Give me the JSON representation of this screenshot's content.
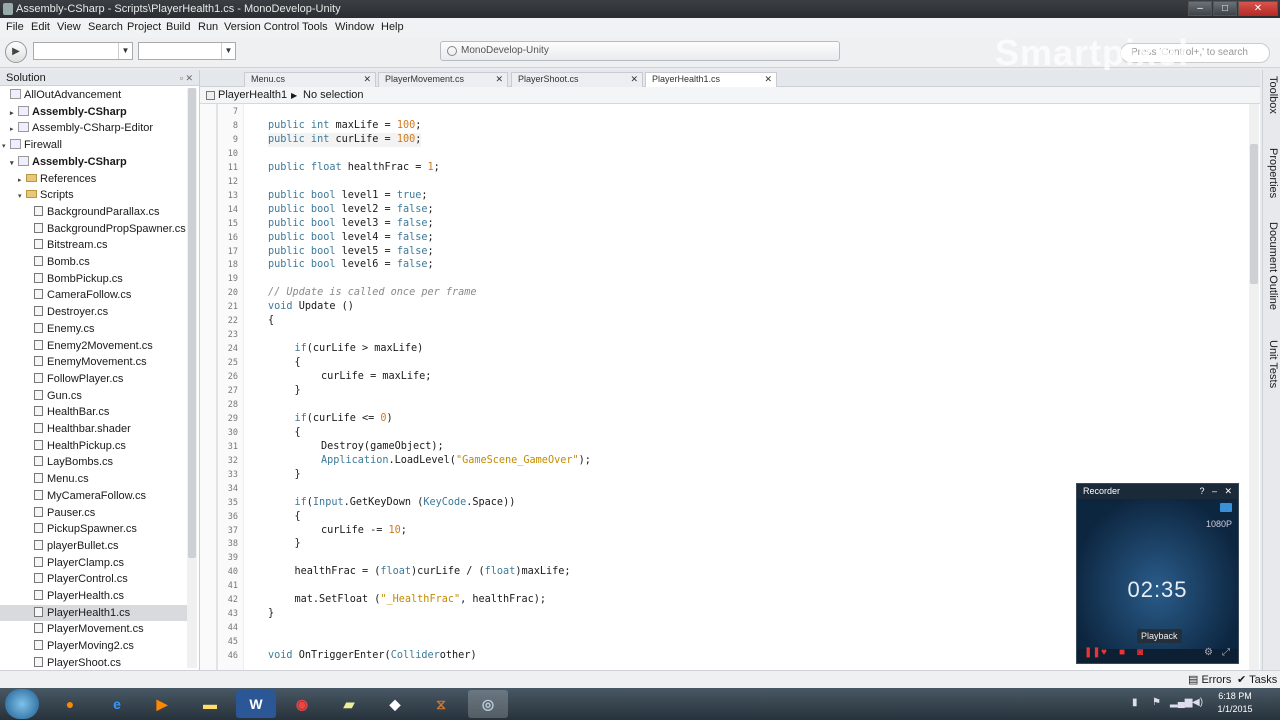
{
  "window": {
    "title": "Assembly-CSharp - Scripts\\PlayerHealth1.cs - MonoDevelop-Unity"
  },
  "menu": [
    "File",
    "Edit",
    "View",
    "Search",
    "Project",
    "Build",
    "Run",
    "Version Control",
    "Tools",
    "Window",
    "Help"
  ],
  "toolbar": {
    "status_text": "MonoDevelop-Unity",
    "search_placeholder": "Press 'Control+,' to search"
  },
  "watermark": "Smartpixel",
  "solution": {
    "title": "Solution",
    "items": [
      {
        "label": "AllOutAdvancement",
        "level": 0,
        "expand": "",
        "type": "sln",
        "bold": false
      },
      {
        "label": "Assembly-CSharp",
        "level": 1,
        "expand": "▸",
        "type": "proj",
        "bold": true
      },
      {
        "label": "Assembly-CSharp-Editor",
        "level": 1,
        "expand": "▸",
        "type": "proj",
        "bold": false
      },
      {
        "label": "Firewall",
        "level": 0,
        "expand": "▾",
        "type": "sln",
        "bold": false
      },
      {
        "label": "Assembly-CSharp",
        "level": 1,
        "expand": "▾",
        "type": "proj",
        "bold": true
      },
      {
        "label": "References",
        "level": 2,
        "expand": "▸",
        "type": "folder",
        "bold": false
      },
      {
        "label": "Scripts",
        "level": 2,
        "expand": "▾",
        "type": "folder",
        "bold": false
      },
      {
        "label": "BackgroundParallax.cs",
        "level": 3,
        "expand": "",
        "type": "file",
        "bold": false
      },
      {
        "label": "BackgroundPropSpawner.cs",
        "level": 3,
        "expand": "",
        "type": "file",
        "bold": false
      },
      {
        "label": "Bitstream.cs",
        "level": 3,
        "expand": "",
        "type": "file",
        "bold": false
      },
      {
        "label": "Bomb.cs",
        "level": 3,
        "expand": "",
        "type": "file",
        "bold": false
      },
      {
        "label": "BombPickup.cs",
        "level": 3,
        "expand": "",
        "type": "file",
        "bold": false
      },
      {
        "label": "CameraFollow.cs",
        "level": 3,
        "expand": "",
        "type": "file",
        "bold": false
      },
      {
        "label": "Destroyer.cs",
        "level": 3,
        "expand": "",
        "type": "file",
        "bold": false
      },
      {
        "label": "Enemy.cs",
        "level": 3,
        "expand": "",
        "type": "file",
        "bold": false
      },
      {
        "label": "Enemy2Movement.cs",
        "level": 3,
        "expand": "",
        "type": "file",
        "bold": false
      },
      {
        "label": "EnemyMovement.cs",
        "level": 3,
        "expand": "",
        "type": "file",
        "bold": false
      },
      {
        "label": "FollowPlayer.cs",
        "level": 3,
        "expand": "",
        "type": "file",
        "bold": false
      },
      {
        "label": "Gun.cs",
        "level": 3,
        "expand": "",
        "type": "file",
        "bold": false
      },
      {
        "label": "HealthBar.cs",
        "level": 3,
        "expand": "",
        "type": "file",
        "bold": false
      },
      {
        "label": "Healthbar.shader",
        "level": 3,
        "expand": "",
        "type": "file",
        "bold": false
      },
      {
        "label": "HealthPickup.cs",
        "level": 3,
        "expand": "",
        "type": "file",
        "bold": false
      },
      {
        "label": "LayBombs.cs",
        "level": 3,
        "expand": "",
        "type": "file",
        "bold": false
      },
      {
        "label": "Menu.cs",
        "level": 3,
        "expand": "",
        "type": "file",
        "bold": false
      },
      {
        "label": "MyCameraFollow.cs",
        "level": 3,
        "expand": "",
        "type": "file",
        "bold": false
      },
      {
        "label": "Pauser.cs",
        "level": 3,
        "expand": "",
        "type": "file",
        "bold": false
      },
      {
        "label": "PickupSpawner.cs",
        "level": 3,
        "expand": "",
        "type": "file",
        "bold": false
      },
      {
        "label": "playerBullet.cs",
        "level": 3,
        "expand": "",
        "type": "file",
        "bold": false
      },
      {
        "label": "PlayerClamp.cs",
        "level": 3,
        "expand": "",
        "type": "file",
        "bold": false
      },
      {
        "label": "PlayerControl.cs",
        "level": 3,
        "expand": "",
        "type": "file",
        "bold": false
      },
      {
        "label": "PlayerHealth.cs",
        "level": 3,
        "expand": "",
        "type": "file",
        "bold": false
      },
      {
        "label": "PlayerHealth1.cs",
        "level": 3,
        "expand": "",
        "type": "file",
        "bold": false,
        "selected": true
      },
      {
        "label": "PlayerMovement.cs",
        "level": 3,
        "expand": "",
        "type": "file",
        "bold": false
      },
      {
        "label": "PlayerMoving2.cs",
        "level": 3,
        "expand": "",
        "type": "file",
        "bold": false
      },
      {
        "label": "PlayerShoot.cs",
        "level": 3,
        "expand": "",
        "type": "file",
        "bold": false
      }
    ]
  },
  "tabs": [
    {
      "label": "Menu.cs"
    },
    {
      "label": "PlayerMovement.cs"
    },
    {
      "label": "PlayerShoot.cs"
    },
    {
      "label": "PlayerHealth1.cs",
      "active": true
    }
  ],
  "breadcrumb": {
    "class_name": "PlayerHealth1",
    "selection": "No selection"
  },
  "code": [
    {
      "n": "7",
      "t": []
    },
    {
      "n": "8",
      "t": [
        [
          "kw",
          "public int"
        ],
        [
          "",
          "maxLife = "
        ],
        [
          "num",
          "100"
        ],
        [
          "",
          ";"
        ]
      ],
      "indent": 1
    },
    {
      "n": "9",
      "t": [
        [
          "kw",
          "public int"
        ],
        [
          "",
          "curLife = "
        ],
        [
          "num",
          "100"
        ],
        [
          "",
          ";"
        ]
      ],
      "indent": 1,
      "hl": true
    },
    {
      "n": "10",
      "t": []
    },
    {
      "n": "11",
      "t": [
        [
          "kw",
          "public float"
        ],
        [
          "",
          "healthFrac = "
        ],
        [
          "num",
          "1"
        ],
        [
          "",
          ";"
        ]
      ],
      "indent": 1
    },
    {
      "n": "12",
      "t": []
    },
    {
      "n": "13",
      "t": [
        [
          "kw",
          "public bool"
        ],
        [
          "",
          "level1 = "
        ],
        [
          "kw",
          "true"
        ],
        [
          "",
          ";"
        ]
      ],
      "indent": 1
    },
    {
      "n": "14",
      "t": [
        [
          "kw",
          "public bool"
        ],
        [
          "",
          "level2 = "
        ],
        [
          "kw",
          "false"
        ],
        [
          "",
          ";"
        ]
      ],
      "indent": 1
    },
    {
      "n": "15",
      "t": [
        [
          "kw",
          "public bool"
        ],
        [
          "",
          "level3 = "
        ],
        [
          "kw",
          "false"
        ],
        [
          "",
          ";"
        ]
      ],
      "indent": 1
    },
    {
      "n": "16",
      "t": [
        [
          "kw",
          "public bool"
        ],
        [
          "",
          "level4 = "
        ],
        [
          "kw",
          "false"
        ],
        [
          "",
          ";"
        ]
      ],
      "indent": 1
    },
    {
      "n": "17",
      "t": [
        [
          "kw",
          "public bool"
        ],
        [
          "",
          "level5 = "
        ],
        [
          "kw",
          "false"
        ],
        [
          "",
          ";"
        ]
      ],
      "indent": 1
    },
    {
      "n": "18",
      "t": [
        [
          "kw",
          "public bool"
        ],
        [
          "",
          "level6 = "
        ],
        [
          "kw",
          "false"
        ],
        [
          "",
          ";"
        ]
      ],
      "indent": 1
    },
    {
      "n": "19",
      "t": []
    },
    {
      "n": "20",
      "t": [
        [
          "cm",
          "// Update is called once per frame"
        ]
      ],
      "indent": 1
    },
    {
      "n": "21",
      "t": [
        [
          "kw",
          "void"
        ],
        [
          "",
          "Update ()"
        ]
      ],
      "indent": 1
    },
    {
      "n": "22",
      "t": [
        [
          "",
          "{"
        ]
      ],
      "indent": 1
    },
    {
      "n": "23",
      "t": []
    },
    {
      "n": "24",
      "t": [
        [
          "kw",
          "if"
        ],
        [
          "",
          "(curLife > maxLife)"
        ]
      ],
      "indent": 2
    },
    {
      "n": "25",
      "t": [
        [
          "",
          "{"
        ]
      ],
      "indent": 2
    },
    {
      "n": "26",
      "t": [
        [
          "",
          "curLife = maxLife;"
        ]
      ],
      "indent": 3
    },
    {
      "n": "27",
      "t": [
        [
          "",
          "}"
        ]
      ],
      "indent": 2
    },
    {
      "n": "28",
      "t": []
    },
    {
      "n": "29",
      "t": [
        [
          "kw",
          "if"
        ],
        [
          "",
          "(curLife <= "
        ],
        [
          "num",
          "0"
        ],
        [
          "",
          ")"
        ]
      ],
      "indent": 2,
      "nosp": true
    },
    {
      "n": "30",
      "t": [
        [
          "",
          "{"
        ]
      ],
      "indent": 2
    },
    {
      "n": "31",
      "t": [
        [
          "",
          "Destroy(gameObject);"
        ]
      ],
      "indent": 3
    },
    {
      "n": "32",
      "t": [
        [
          "ty",
          "Application"
        ],
        [
          "",
          ".LoadLevel("
        ],
        [
          "str",
          "\"GameScene_GameOver\""
        ],
        [
          "",
          ");"
        ]
      ],
      "indent": 3,
      "nosp": true
    },
    {
      "n": "33",
      "t": [
        [
          "",
          "}"
        ]
      ],
      "indent": 2
    },
    {
      "n": "34",
      "t": []
    },
    {
      "n": "35",
      "t": [
        [
          "kw",
          "if"
        ],
        [
          "",
          "("
        ],
        [
          "ty",
          "Input"
        ],
        [
          "",
          ".GetKeyDown ("
        ],
        [
          "ty",
          "KeyCode"
        ],
        [
          "",
          ".Space))"
        ]
      ],
      "indent": 2,
      "nosp2": true
    },
    {
      "n": "36",
      "t": [
        [
          "",
          "{"
        ]
      ],
      "indent": 2
    },
    {
      "n": "37",
      "t": [
        [
          "",
          "curLife -= "
        ],
        [
          "num",
          "10"
        ],
        [
          "",
          ";"
        ]
      ],
      "indent": 3,
      "nosp": true
    },
    {
      "n": "38",
      "t": [
        [
          "",
          "}"
        ]
      ],
      "indent": 2
    },
    {
      "n": "39",
      "t": []
    },
    {
      "n": "40",
      "t": [
        [
          "",
          "healthFrac = ("
        ],
        [
          "kw",
          "float"
        ],
        [
          "",
          ")curLife / ("
        ],
        [
          "kw",
          "float"
        ],
        [
          "",
          ")maxLife;"
        ]
      ],
      "indent": 2,
      "nosp": true
    },
    {
      "n": "41",
      "t": []
    },
    {
      "n": "42",
      "t": [
        [
          "",
          "mat.SetFloat ("
        ],
        [
          "str",
          "\"_HealthFrac\""
        ],
        [
          "",
          ", healthFrac);"
        ]
      ],
      "indent": 2,
      "nosp": true
    },
    {
      "n": "43",
      "t": [
        [
          "",
          "}"
        ]
      ],
      "indent": 1
    },
    {
      "n": "44",
      "t": []
    },
    {
      "n": "45",
      "t": []
    },
    {
      "n": "46",
      "t": [
        [
          "kw",
          "void"
        ],
        [
          "",
          "OnTriggerEnter("
        ],
        [
          "ty",
          "Collider"
        ],
        [
          "",
          "other)"
        ]
      ],
      "indent": 1
    }
  ],
  "right_dock": [
    "Toolbox",
    "Properties",
    "Document Outline",
    "Unit Tests"
  ],
  "recorder": {
    "title": "Recorder",
    "resolution": "1080P",
    "time": "02:35",
    "playback_label": "Playback"
  },
  "bottom_pads": {
    "errors": "Errors",
    "tasks": "Tasks"
  },
  "taskbar": {
    "time": "6:18 PM",
    "date": "1/1/2015"
  },
  "colors": {
    "keyword": "#3d7a9a",
    "number": "#d07a1e",
    "string": "#c38a00",
    "comment": "#8a8a8a"
  }
}
